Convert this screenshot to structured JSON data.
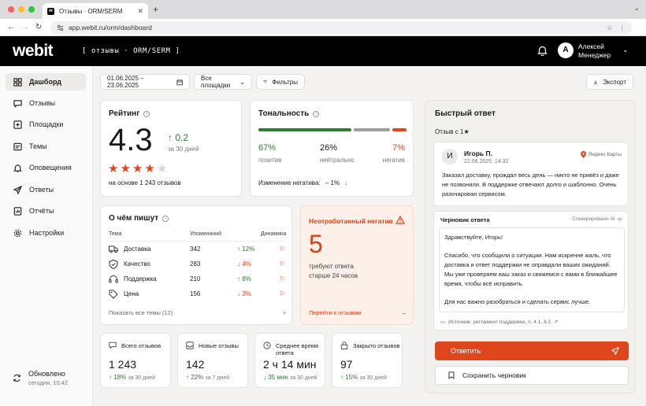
{
  "browser": {
    "tab_title": "Отзывы · ORM/SERM",
    "tab_icon": "webit-favicon",
    "url": "app.webit.ru/orm/dashboard"
  },
  "header": {
    "logo": "webit",
    "section": "[ отзывы · ORM/SERM ]",
    "avatar_letter": "А",
    "user_first": "Алексей",
    "user_role": "Менеджер"
  },
  "sidebar": {
    "items": [
      {
        "label": "Дашборд",
        "icon": "dashboard-icon"
      },
      {
        "label": "Отзывы",
        "icon": "reviews-icon"
      },
      {
        "label": "Площадки",
        "icon": "platforms-icon"
      },
      {
        "label": "Темы",
        "icon": "topics-icon"
      },
      {
        "label": "Оповещения",
        "icon": "bell-icon"
      },
      {
        "label": "Ответы",
        "icon": "reply-icon"
      },
      {
        "label": "Отчёты",
        "icon": "report-icon"
      },
      {
        "label": "Настройки",
        "icon": "gear-icon"
      }
    ],
    "sync_title": "Обновлено",
    "sync_time": "сегодня, 10:42"
  },
  "toolbar": {
    "date_range": "01.06.2025 – 23.06.2025",
    "platforms": "Все площадки",
    "filters": "Фильтры",
    "export": "Экспорт"
  },
  "rating": {
    "title": "Рейтинг",
    "value": "4.3",
    "delta": "0.2",
    "period": "за 30 дней",
    "stars_filled": 4,
    "stars_total": 5,
    "based_on": "на основе 1 243 отзывов"
  },
  "tone": {
    "title": "Тональность",
    "positive_pct": "67%",
    "positive_label": "позитив",
    "neutral_pct": "26%",
    "neutral_label": "нейтрально",
    "negative_pct": "7%",
    "negative_label": "негатив",
    "shares": [
      0.67,
      0.26,
      0.07
    ],
    "change_label": "Изменение негатива:",
    "change_value": "– 1%",
    "colors": {
      "positive": "#2e7d32",
      "neutral": "#9e9e9e",
      "negative": "#e0461b"
    }
  },
  "topics": {
    "title": "О чём пишут",
    "col_topic": "Тема",
    "col_mentions": "Упоминаний",
    "col_dynamic": "Динамика",
    "rows": [
      {
        "icon": "truck-icon",
        "name": "Доставка",
        "mentions": "342",
        "trend": "up",
        "delta": "12%"
      },
      {
        "icon": "shield-icon",
        "name": "Качество",
        "mentions": "283",
        "trend": "down",
        "delta": "4%"
      },
      {
        "icon": "headset-icon",
        "name": "Поддержка",
        "mentions": "210",
        "trend": "up",
        "delta": "8%"
      },
      {
        "icon": "tag-icon",
        "name": "Цена",
        "mentions": "156",
        "trend": "down",
        "delta": "3%"
      }
    ],
    "show_all": "Показать все темы (12)"
  },
  "negative": {
    "title": "Неотработанный негатив",
    "count": "5",
    "line1": "требуют ответа",
    "line2": "старше 24 часов",
    "link": "Перейти к отзывам",
    "accent": "#e0461b"
  },
  "stats": [
    {
      "icon": "chat-icon",
      "label": "Всего отзывов",
      "value": "1 243",
      "delta": "18%",
      "period": "за 30 дней",
      "trend": "up"
    },
    {
      "icon": "inbox-icon",
      "label": "Новые отзывы",
      "value": "142",
      "delta": "22%",
      "period": "за 7 дней",
      "trend": "up"
    },
    {
      "icon": "clock-icon",
      "label": "Среднее время ответа",
      "value": "2 ч 14 мин",
      "delta": "35 мин",
      "period": "за 30 дней",
      "trend": "down"
    },
    {
      "icon": "lock-icon",
      "label": "Закрыто отзывов",
      "value": "97",
      "delta": "15%",
      "period": "за 30 дней",
      "trend": "up"
    }
  ],
  "quick_reply": {
    "title": "Быстрый ответ",
    "filter": "Отзыв с 1★",
    "review": {
      "avatar": "И",
      "author": "Игорь П.",
      "date": "22.06.2025, 14:32",
      "source": "Яндекс Карты",
      "text": "Заказал доставку, прождал весь день — никто не привёз и даже не позвонили. В поддержке отвечают долго и шаблонно. Очень разочарован сервисом."
    },
    "draft_label": "Черновик ответа",
    "generated": "Сгенерировано AI",
    "draft_greeting": "Здравствуйте, Игорь!",
    "draft_body": "Спасибо, что сообщили о ситуации. Нам искренне жаль, что доставка и ответ поддержки не оправдали ваших ожиданий. Мы уже проверяем ваш заказ и свяжемся с вами в ближайшее время, чтобы всё исправить.",
    "draft_closing": "Для нас важно разобраться и сделать сервис лучше.",
    "source_note": "Источник: регламент поддержки, п. 4.1, 4.3",
    "reply_button": "Ответить",
    "save_button": "Сохранить черновик",
    "accent": "#e0461b"
  }
}
